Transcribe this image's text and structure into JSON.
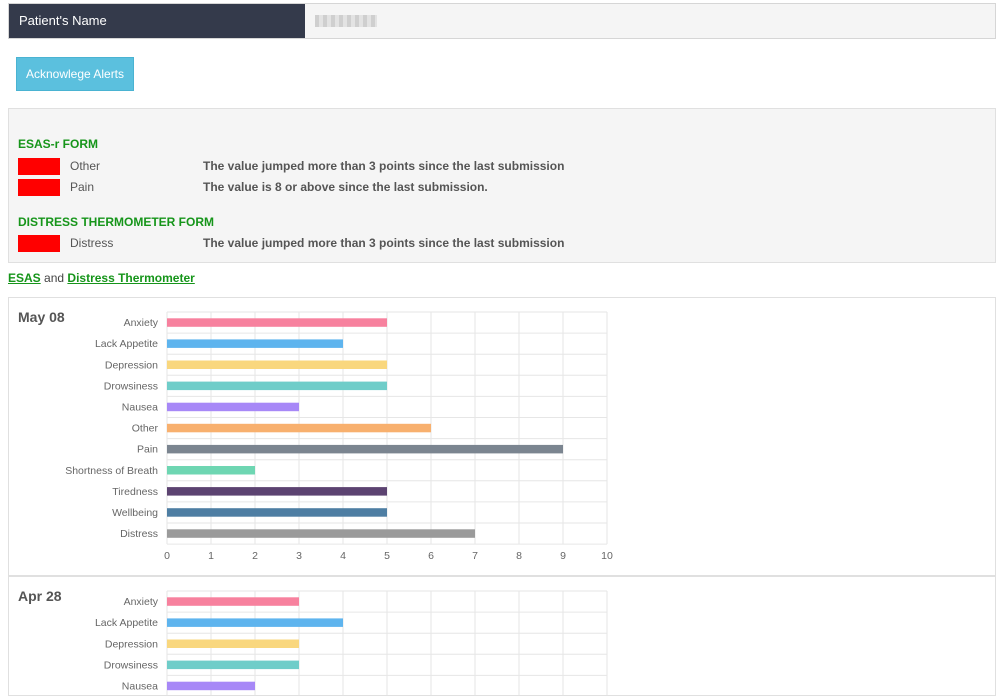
{
  "patient": {
    "label": "Patient's Name",
    "value_redacted": true
  },
  "acknowledge_button": "Acknowlege Alerts",
  "alerts": {
    "forms": [
      {
        "title": "ESAS-r FORM",
        "items": [
          {
            "name": "Other",
            "message": "The value jumped more than 3 points since the last submission"
          },
          {
            "name": "Pain",
            "message": "The value is 8 or above since the last submission."
          }
        ]
      },
      {
        "title": "DISTRESS THERMOMETER FORM",
        "items": [
          {
            "name": "Distress",
            "message": "The value jumped more than 3 points since the last submission"
          }
        ]
      }
    ],
    "swatch_color": "#ff0000"
  },
  "links": {
    "esas": "ESAS",
    "and": "and",
    "distress": "Distress Thermometer"
  },
  "chart_data": [
    {
      "type": "bar",
      "orientation": "horizontal",
      "title": "May 08",
      "categories": [
        "Anxiety",
        "Lack Appetite",
        "Depression",
        "Drowsiness",
        "Nausea",
        "Other",
        "Pain",
        "Shortness of Breath",
        "Tiredness",
        "Wellbeing",
        "Distress"
      ],
      "values": [
        5,
        4,
        5,
        5,
        3,
        6,
        9,
        2,
        5,
        5,
        7
      ],
      "colors": [
        "#f7819e",
        "#5eb4ee",
        "#f9d77e",
        "#6fcdc9",
        "#a788f7",
        "#f8b06e",
        "#7b8590",
        "#6ed6b2",
        "#5c4371",
        "#4e7ea3",
        "#9a9a9a"
      ],
      "xlim": [
        0,
        10
      ],
      "xticks": [
        "0",
        "1",
        "2",
        "3",
        "4",
        "5",
        "6",
        "7",
        "8",
        "9",
        "10"
      ],
      "grid": true
    },
    {
      "type": "bar",
      "orientation": "horizontal",
      "title": "Apr 28",
      "categories": [
        "Anxiety",
        "Lack Appetite",
        "Depression",
        "Drowsiness",
        "Nausea"
      ],
      "values": [
        3,
        4,
        3,
        3,
        2
      ],
      "colors": [
        "#f7819e",
        "#5eb4ee",
        "#f9d77e",
        "#6fcdc9",
        "#a788f7"
      ],
      "xlim": [
        0,
        10
      ],
      "grid": true
    }
  ]
}
